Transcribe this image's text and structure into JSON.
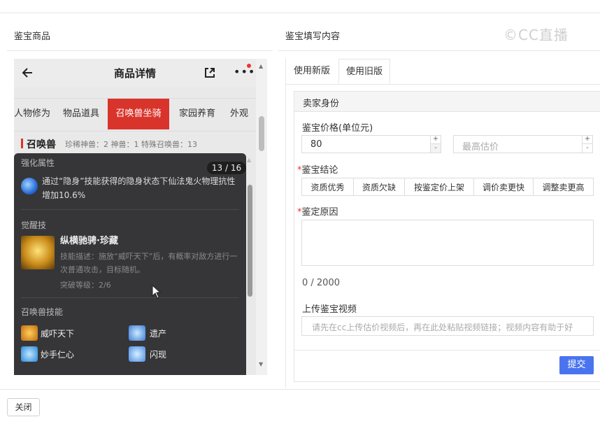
{
  "left_panel": {
    "title": "鉴宝商品"
  },
  "right_panel": {
    "title": "鉴宝填写内容",
    "watermark": "©CC直播"
  },
  "phone": {
    "header_title": "商品详情",
    "tabs": [
      "人物修为",
      "物品道具",
      "召唤兽坐骑",
      "家园养育",
      "外观"
    ],
    "active_tab": "召唤兽坐骑",
    "pet_title": "召唤兽",
    "pet_stats": "珍稀神兽：2  神兽：1  特殊召唤兽：13",
    "overlay": {
      "counter": "13 / 16",
      "section1_title": "强化属性",
      "section1_text": "通过“隐身”技能获得的隐身状态下仙法鬼火物理抗性增加10.6%",
      "section2_title": "觉醒技",
      "awaken_name": "纵横驰骋·珍藏",
      "awaken_desc": "技能描述：施放“威吓天下”后，有概率对敌方进行一次普通攻击，目标随机。",
      "awaken_level": "突破等级：2/6",
      "section3_title": "召唤兽技能",
      "skills": [
        "威吓天下",
        "遗产",
        "妙手仁心",
        "闪现"
      ]
    }
  },
  "form": {
    "tabs": [
      "使用新版",
      "使用旧版"
    ],
    "active_tab": "使用旧版",
    "section_head": "卖家身份",
    "price_label": "鉴宝价格(单位元)",
    "price_value": "80",
    "max_placeholder": "最高估价",
    "conclusion_label": "鉴宝结论",
    "conclusion_options": [
      "资质优秀",
      "资质欠缺",
      "按鉴定价上架",
      "调价卖更快",
      "调整卖更高"
    ],
    "reason_label": "鉴定原因",
    "reason_counter": "0 / 2000",
    "video_label": "上传鉴宝视频",
    "video_placeholder": "请先在cc上传估价视频后，再在此处粘贴视频链接；视频内容有助于好",
    "submit_label": "提交"
  },
  "footer": {
    "close_label": "关闭"
  },
  "colors": {
    "accent_red": "#d9342b",
    "primary_blue": "#4a74ef"
  }
}
